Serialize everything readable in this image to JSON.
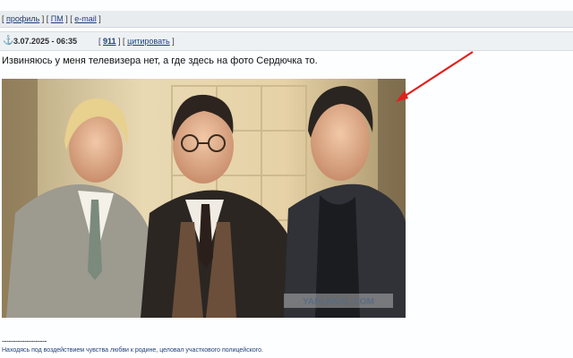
{
  "prev_post": {
    "links": [
      "профиль",
      "ПМ",
      "e-mail"
    ]
  },
  "post": {
    "date": "3.07.2025 - 06:35",
    "number": "911",
    "quote_label": "цитировать",
    "text": "Извиняюсь у меня телевизера нет, а где здесь на фото Сердючка то.",
    "image": {
      "watermark": "YAPLAKAL.COM"
    }
  },
  "signature": {
    "separator": "--------------------",
    "text": "Находясь под воздействием чувства любви к родине, целовал участкового полицейского."
  },
  "colors": {
    "link": "#1f3f7a",
    "post_number": "#c00000",
    "arrow": "#e0201c"
  },
  "icons": {
    "anchor": "anchor-icon"
  }
}
